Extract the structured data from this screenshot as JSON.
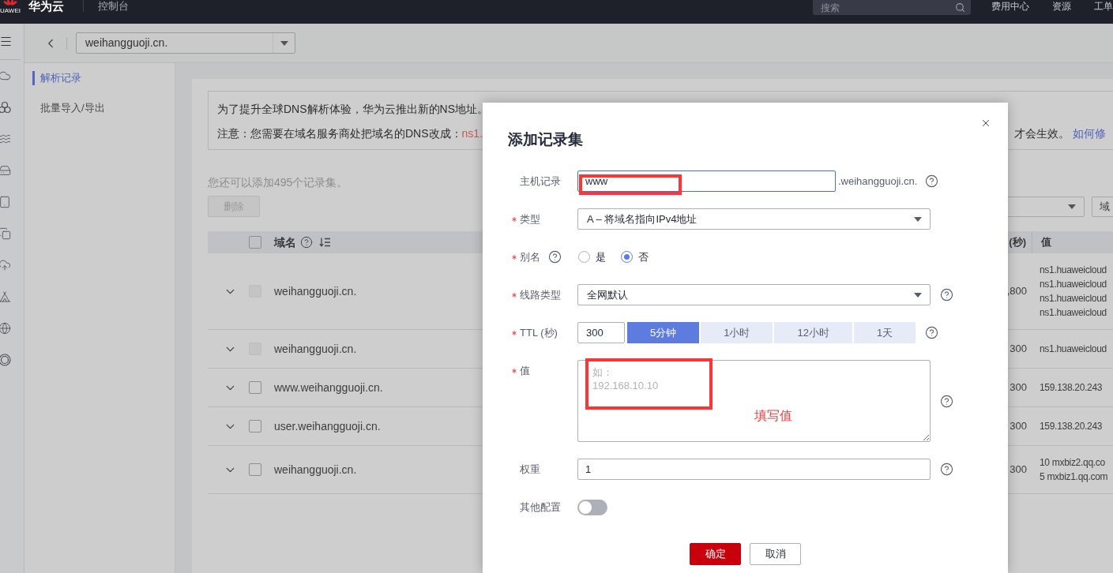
{
  "top_bar": {
    "logo_text": "UAWEI",
    "brand": "华为云",
    "console": "控制台",
    "search": {
      "placeholder": "搜索"
    },
    "links": [
      "费用中心",
      "资源",
      "工单"
    ]
  },
  "breadcrumb": {
    "domain": "weihangguoji.cn."
  },
  "sidebar": {
    "items": [
      {
        "label": "解析记录",
        "selected": true
      },
      {
        "label": "批量导入/导出",
        "selected": false
      }
    ]
  },
  "notice": {
    "line_1": "为了提升全球DNS解析体验，华为云推出新的NS地址。",
    "line_2": {
      "text": "注意：您需要在域名服务商处把域名的DNS改成：",
      "highlight": "ns1."
    },
    "line_2_end": {
      "text": "才会生效。",
      "link": "如何修"
    }
  },
  "quota": "您还可以添加495个记录集。",
  "toolbar": {
    "delete_button": {
      "label": "删除",
      "disabled": true
    },
    "search_button": "域"
  },
  "table": {
    "select_all": {
      "checked": false
    },
    "columns": [
      {
        "label": "域名",
        "help": true,
        "sortable": true
      },
      {
        "label": "(秒)",
        "help": false,
        "sortable": false
      },
      {
        "label": "值",
        "help": false,
        "sortable": false
      }
    ],
    "rows": [
      {
        "expanded": false,
        "disabled": true,
        "checked": false,
        "domain": "weihangguoji.cn.",
        "column_2": ",800",
        "values": [
          "ns1.huaweicloud",
          "ns1.huaweicloud",
          "ns1.huaweicloud",
          "ns1.huaweicloud"
        ]
      },
      {
        "expanded": false,
        "disabled": true,
        "checked": false,
        "domain": "weihangguoji.cn.",
        "column_2": "300",
        "values": [
          "ns1.huaweicloud"
        ]
      },
      {
        "expanded": false,
        "disabled": false,
        "checked": false,
        "domain": "www.weihangguoji.cn.",
        "column_2": "300",
        "values": [
          "159.138.20.243"
        ]
      },
      {
        "expanded": false,
        "disabled": false,
        "checked": false,
        "domain": "user.weihangguoji.cn.",
        "column_2": "300",
        "values": [
          "159.138.20.243"
        ]
      },
      {
        "expanded": false,
        "disabled": false,
        "checked": false,
        "domain": "weihangguoji.cn.",
        "column_2": "300",
        "values": [
          "10 mxbiz2.qq.co",
          "5 mxbiz1.qq.com"
        ]
      }
    ]
  },
  "dialog": {
    "title": "添加记录集",
    "fields": [
      {
        "kind": "text",
        "label": "主机记录",
        "required": false,
        "label_help": false,
        "help": true,
        "value": "www",
        "suffix": ".weihangguoji.cn.",
        "focused": true,
        "highlighted": true
      },
      {
        "kind": "select",
        "label": "类型",
        "required": true,
        "label_help": false,
        "help": false,
        "value": "A – 将域名指向IPv4地址"
      },
      {
        "kind": "radio",
        "label": "别名",
        "required": true,
        "label_help": true,
        "help": false,
        "options": [
          {
            "label": "是",
            "selected": false
          },
          {
            "label": "否",
            "selected": true
          }
        ]
      },
      {
        "kind": "select",
        "label": "线路类型",
        "required": true,
        "label_help": false,
        "help": true,
        "value": "全网默认"
      },
      {
        "kind": "ttl",
        "label": "TTL (秒)",
        "required": true,
        "label_help": false,
        "help": true,
        "value": "300",
        "options": [
          {
            "label": "5分钟",
            "selected": true
          },
          {
            "label": "1小时",
            "selected": false
          },
          {
            "label": "12小时",
            "selected": false
          },
          {
            "label": "1天",
            "selected": false
          }
        ]
      },
      {
        "kind": "textarea",
        "label": "值",
        "required": true,
        "label_help": false,
        "help": true,
        "placeholder": "如：\n192.168.10.10",
        "highlighted": true,
        "note": "填写值"
      },
      {
        "kind": "text",
        "label": "权重",
        "required": false,
        "label_help": false,
        "help": true,
        "value": "1",
        "focused": false,
        "highlighted": false
      },
      {
        "kind": "switch",
        "label": "其他配置",
        "required": false,
        "label_help": false,
        "help": false,
        "on": false
      }
    ],
    "buttons": [
      {
        "label": "确定",
        "kind": "primary"
      },
      {
        "label": "取消",
        "kind": "secondary"
      }
    ]
  }
}
